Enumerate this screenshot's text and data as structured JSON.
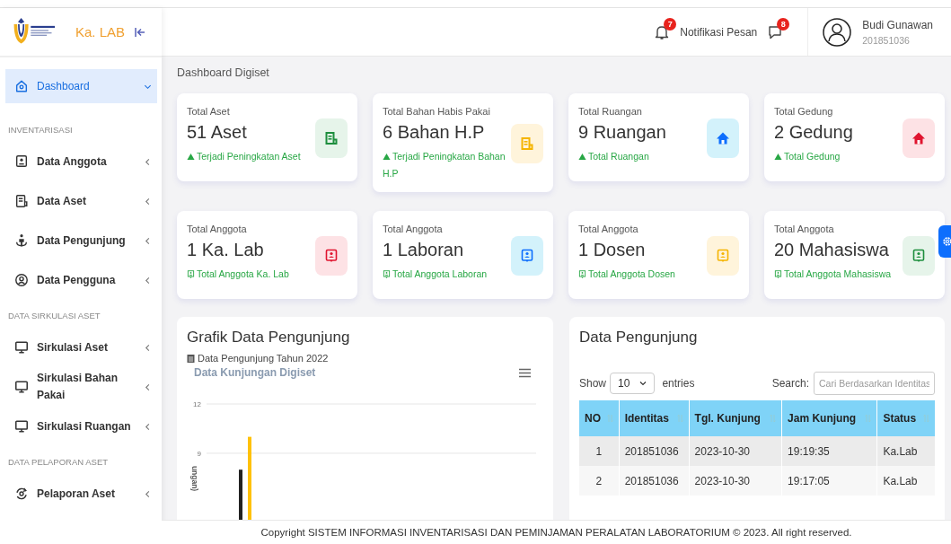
{
  "brand": {
    "title": "Ka. LAB"
  },
  "sidebar": {
    "items": [
      {
        "kind": "item",
        "label": "Dashboard",
        "selected": true
      },
      {
        "kind": "section",
        "label": "INVENTARISASI"
      },
      {
        "kind": "item",
        "label": "Data Anggota",
        "selected": false
      },
      {
        "kind": "item",
        "label": "Data Aset",
        "selected": false
      },
      {
        "kind": "item",
        "label": "Data Pengunjung",
        "selected": false
      },
      {
        "kind": "item",
        "label": "Data Pengguna",
        "selected": false
      },
      {
        "kind": "section",
        "label": "DATA SIRKULASI ASET"
      },
      {
        "kind": "item",
        "label": "Sirkulasi Aset",
        "selected": false
      },
      {
        "kind": "item",
        "label": "Sirkulasi Bahan Pakai",
        "selected": false
      },
      {
        "kind": "item",
        "label": "Sirkulasi Ruangan",
        "selected": false
      },
      {
        "kind": "section",
        "label": "DATA PELAPORAN ASET"
      },
      {
        "kind": "item",
        "label": "Pelaporan Aset",
        "selected": false
      }
    ]
  },
  "header": {
    "notification_badge": "7",
    "message_label": "Notifikasi Pesan",
    "message_badge": "8",
    "user_name": "Budi Gunawan",
    "user_id": "201851036"
  },
  "breadcrumb": "Dashboard Digiset",
  "cards": [
    {
      "kind": "doc",
      "title": "Total Aset",
      "value": "51 Aset",
      "note": "Terjadi Peningkatan Aset",
      "color": "#1e8e3e"
    },
    {
      "kind": "doc",
      "title": "Total Bahan Habis Pakai",
      "value": "6 Bahan H.P",
      "note": "Terjadi Peningkatan Bahan H.P",
      "color": "#f5b400"
    },
    {
      "kind": "house",
      "title": "Total Ruangan",
      "value": "9 Ruangan",
      "note": "Total Ruangan",
      "color": "#0d6efd"
    },
    {
      "kind": "house",
      "title": "Total Gedung",
      "value": "2 Gedung",
      "note": "Total Gedung",
      "color": "#e0142f"
    },
    {
      "kind": "member",
      "title": "Total Anggota",
      "value": "1 Ka. Lab",
      "note": "Total Anggota Ka. Lab",
      "color": "#e0142f"
    },
    {
      "kind": "member",
      "title": "Total Anggota",
      "value": "1 Laboran",
      "note": "Total Anggota Laboran",
      "color": "#0d6efd"
    },
    {
      "kind": "member",
      "title": "Total Anggota",
      "value": "1 Dosen",
      "note": "Total Anggota Dosen",
      "color": "#f5b400"
    },
    {
      "kind": "member",
      "title": "Total Anggota",
      "value": "20 Mahasiswa",
      "note": "Total Anggota Mahasiswa",
      "color": "#1e8e3e"
    }
  ],
  "chart_panel": {
    "title": "Grafik Data Pengunjung",
    "subtitle": "Data Pengunjung Tahun 2022",
    "chart_data": {
      "type": "bar",
      "title": "Data Kunjungan Digiset",
      "ylabel": "ungan)",
      "ylim": [
        0,
        12
      ],
      "yticks": [
        9,
        12
      ],
      "series": [
        {
          "color": "#222222",
          "values": [
            8
          ]
        },
        {
          "color": "#ffc107",
          "values": [
            10
          ]
        }
      ]
    }
  },
  "table_panel": {
    "title": "Data Pengunjung",
    "show_label": "Show",
    "entries_value": "10",
    "entries_label": "entries",
    "search_label": "Search:",
    "search_placeholder": "Cari Berdasarkan Identitas",
    "columns": [
      "NO",
      "Identitas",
      "Tgl. Kunjung",
      "Jam Kunjung",
      "Status"
    ],
    "rows": [
      [
        "1",
        "201851036",
        "2023-10-30",
        "19:19:35",
        "Ka.Lab"
      ],
      [
        "2",
        "201851036",
        "2023-10-30",
        "19:17:05",
        "Ka.Lab"
      ]
    ]
  },
  "footer": "Copyright SISTEM INFORMASI INVENTARISASI DAN PEMINJAMAN PERALATAN LABORATORIUM © 2023. All right reserved."
}
